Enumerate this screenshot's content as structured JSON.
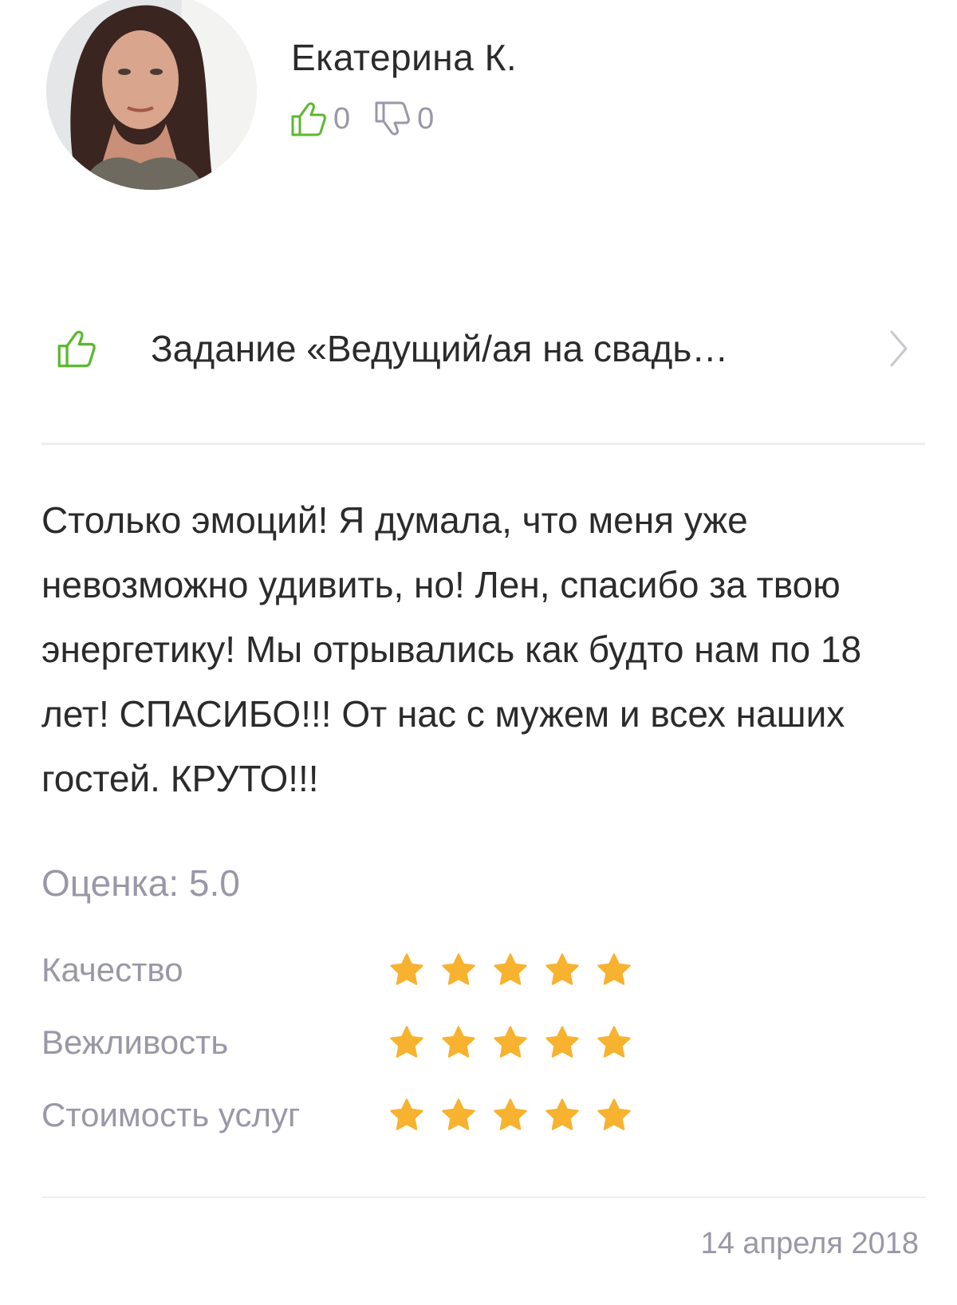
{
  "author": {
    "name": "Екатерина К.",
    "avatar_icon": "user-photo"
  },
  "votes": {
    "likes": "0",
    "dislikes": "0",
    "like_icon": "thumbs-up-icon",
    "dislike_icon": "thumbs-down-icon"
  },
  "task": {
    "title": "Задание «Ведущий/ая на свадь…",
    "icon": "thumbs-up-icon",
    "arrow_icon": "chevron-right-icon"
  },
  "review": {
    "text": "Столько эмоций! Я думала, что меня уже невозможно удивить, но! Лен, спасибо за твою энергетику! Мы отрывались как будто нам по 18 лет! СПАСИБО!!! От нас с мужем и всех наших гостей. КРУТО!!!"
  },
  "rating": {
    "total_label": "Оценка: 5.0",
    "criteria": [
      {
        "label": "Качество",
        "stars": 5,
        "max": 5
      },
      {
        "label": "Вежливость",
        "stars": 5,
        "max": 5
      },
      {
        "label": "Стоимость услуг",
        "stars": 5,
        "max": 5
      }
    ]
  },
  "date": "14 апреля 2018",
  "colors": {
    "accent_green": "#5bb82e",
    "star": "#f7b22f",
    "muted": "#9a97a7",
    "text": "#2b2b2b"
  }
}
